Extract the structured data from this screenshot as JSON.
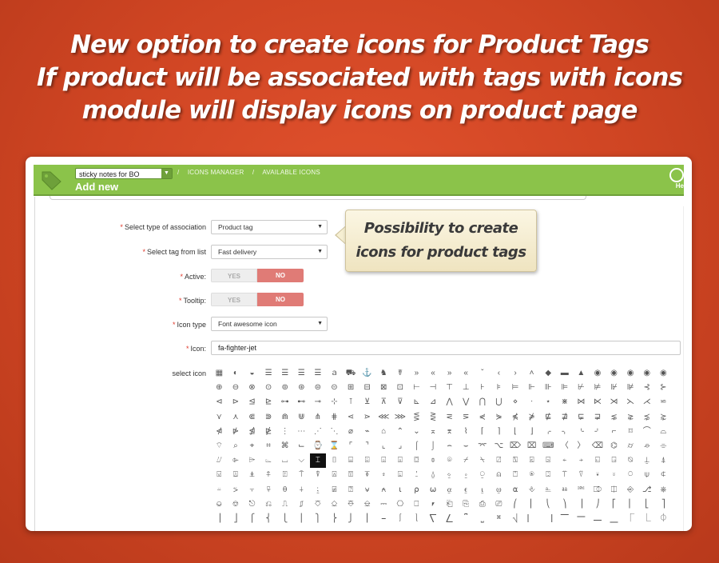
{
  "headline": {
    "line1": "New option to create icons for Product Tags",
    "line2": "If product will be associated with tags with icons",
    "line3": "module will display icons on product page"
  },
  "toolbar": {
    "shop_selector": "sticky notes for BO",
    "breadcrumb": [
      "ICONS MANAGER",
      "AVAILABLE ICONS"
    ],
    "page_title": "Add new",
    "help_label": "He"
  },
  "form": {
    "association_label": "Select type of association",
    "association_value": "Product tag",
    "tag_label": "Select tag from list",
    "tag_value": "Fast delivery",
    "active_label": "Active:",
    "tooltip_label": "Tooltip:",
    "yes": "YES",
    "no": "NO",
    "icon_type_label": "Icon type",
    "icon_type_value": "Font awesome icon",
    "icon_label": "Icon:",
    "icon_value": "fa-fighter-jet",
    "select_icon_label": "select icon"
  },
  "callout": {
    "line1": "Possibility to create",
    "line2": "icons for product tags"
  },
  "icon_grid": {
    "selected_index": 174,
    "glyphs": "▦◐◒☰☰☰☰ａ⛟⚓♞☤»«»«ˇ‹›˄◆▬▲◉◉◉◉◉⊕⊖⊗⊙⊚⊛⊜⊝⊞⊟⊠⊡⊢⊣⊤⊥⊦⊧⊨⊩⊪⊫⊬⊭⊮⊯⊰⊱⊲⊳⊴⊵⊶⊷⊸⊹⊺⊻⊼⊽⊾⊿⋀⋁⋂⋃⋄⋅⋆⋇⋈⋉⋊⋋⋌⋍⋎⋏⋐⋑⋒⋓⋔⋕⋖⋗⋘⋙⋚⋛⋜⋝⋞⋟⋠⋡⋢⋣⋤⋥⋦⋧⋨⋩⋪⋫⋬⋭⋮⋯⋰⋱⌀⌁⌂⌃⌄⌅⌆⌇⌈⌉⌊⌋⌌⌍⌎⌏⌐⌑⌒⌓⌔⌕⌖⌗⌘⌙⌚⌛⌜⌝⌞⌟⌠⌡⌢⌣⌤⌥⌦⌧⌨〈〉⌫⌬⌭⌮⌯⌰⌱⌲⌳⌴⌵⌶⌷⌸⌹⌺⌻⌼⌽⌾⌿⍀⍁⍂⍃⍄⍅⍆⍇⍈⍉⍊⍋⍌⍍⍎⍏⍐⍑⍒⍓⍔⍕⍖⍗⍘⍙⍚⍛⍜⍝⍞⍟⍠⍡⍢⍣⍤⍥⍦⍧⍨⍩⍪⍫⍬⍭⍮⍯⍰⍱⍲⍳⍴⍵⍶⍷⍸⍹⍺⎀⎁⎂⎃⎄⎅⎆⎇⎈⎉⎊⎋⎌⎍⎎⎏⎐⎑⎒⎓⎔⎕⎖⎗⎘⎙⎚⎛⎜⎝⎞⎟⎠⎡⎢⎣⎤⎥⎦⎧⎨⎩⎪⎫⎬⎭⎮⎯⎰⎱⎲⎳⎴⎵⎶⎷⎸⎹⎺⎻⎼⎽⎾⎿⏀⏁⏂⏃⏄⏅⏆⏇⏈⏉⏊⏋⏌⏍⏎⏏⏐⏑⏒⏓⏔⏕⏖⏗⏘⏙⏚⏛⏜⏝⏞⏟⏠⏡⏢⏣⏤⏥⏦⏧⏨⏩⏪⏫⏬⏭⏮⏯⏰⏱⏲⏳"
  },
  "colors": {
    "background": "#cf4523",
    "topbar": "#8bc34a",
    "no_toggle": "#e07b76"
  }
}
